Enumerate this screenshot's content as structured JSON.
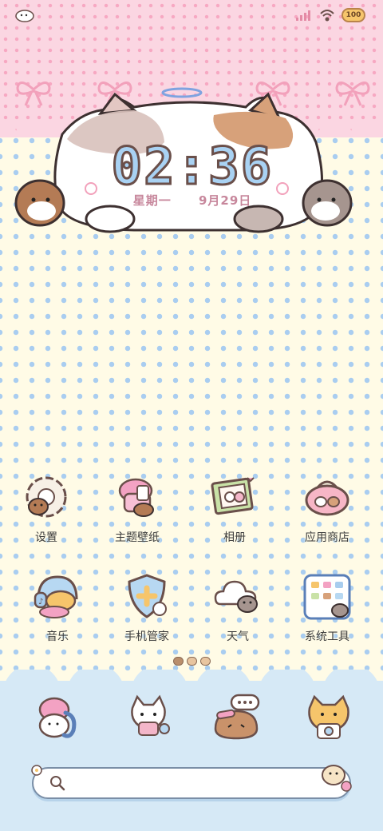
{
  "status_bar": {
    "battery": "100"
  },
  "clock": {
    "time": "02:36",
    "weekday": "星期一",
    "date": "9月29日"
  },
  "apps": [
    {
      "label": "设置",
      "icon": "gear-bunny-icon"
    },
    {
      "label": "主题壁纸",
      "icon": "theme-bunny-icon"
    },
    {
      "label": "相册",
      "icon": "photo-frame-icon"
    },
    {
      "label": "应用商店",
      "icon": "shop-bag-icon"
    },
    {
      "label": "音乐",
      "icon": "music-headphones-icon"
    },
    {
      "label": "手机管家",
      "icon": "shield-plus-icon"
    },
    {
      "label": "天气",
      "icon": "weather-cloud-icon"
    },
    {
      "label": "系统工具",
      "icon": "tools-folder-icon"
    }
  ],
  "dock": [
    {
      "icon": "phone-bunny-icon"
    },
    {
      "icon": "messages-cat-icon"
    },
    {
      "icon": "chat-bread-icon"
    },
    {
      "icon": "camera-hamster-icon"
    }
  ],
  "search": {
    "placeholder": ""
  },
  "colors": {
    "top_band": "#fbd6e2",
    "background": "#fffbe6",
    "dots": "#a9cdf0",
    "dock": "#d6e9f6",
    "clock_digits": "#a9d2f3",
    "date_text": "#c7879c"
  }
}
